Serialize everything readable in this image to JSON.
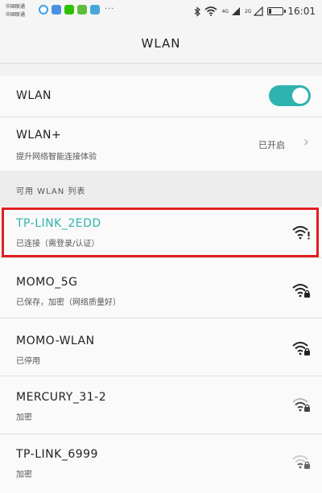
{
  "statusbar": {
    "carrier_1": "中国联通",
    "carrier_2": "中国联通",
    "dots": "···",
    "net_1": "4G",
    "net_2": "2G",
    "time": "16:01",
    "battery_level": 0.2
  },
  "header": {
    "title": "WLAN"
  },
  "settings": {
    "wlan_label": "WLAN",
    "wlan_enabled": true,
    "wlan_plus_label": "WLAN+",
    "wlan_plus_desc": "提升网络智能连接体验",
    "wlan_plus_state": "已开启"
  },
  "section_title": "可用 WLAN 列表",
  "networks": [
    {
      "ssid": "TP-LINK_2EDD",
      "status": "已连接（需登录/认证）",
      "signal_color": "#222222"
    },
    {
      "ssid": "MOMO_5G",
      "status": "已保存，加密（网络质量好）",
      "signal_color": "#222222"
    },
    {
      "ssid": "MOMO-WLAN",
      "status": "已停用",
      "signal_color": "#222222"
    },
    {
      "ssid": "MERCURY_31-2",
      "status": "加密",
      "signal_color": "#555555"
    },
    {
      "ssid": "TP-LINK_6999",
      "status": "加密",
      "signal_color": "#999999"
    }
  ],
  "colors": {
    "accent": "#2fb3ae",
    "highlight": "#e0201f"
  },
  "icons": [
    "signal-icon",
    "wifi-icon",
    "battery-icon",
    "bluetooth-icon",
    "chevron-right-icon",
    "wifi-lock-icon"
  ]
}
